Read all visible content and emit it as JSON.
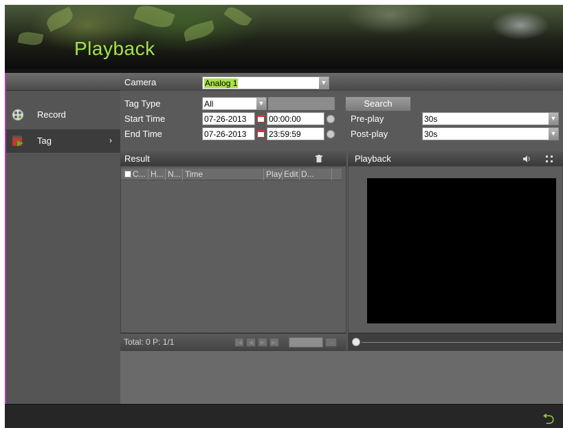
{
  "window": {
    "title": "Playback"
  },
  "sidebar": {
    "items": [
      {
        "label": "Record",
        "icon": "record-icon"
      },
      {
        "label": "Tag",
        "icon": "tag-icon",
        "selected": true
      }
    ]
  },
  "form": {
    "camera_label": "Camera",
    "camera_value": "Analog 1",
    "tag_type_label": "Tag Type",
    "tag_type_value": "All",
    "tag_keyword_value": "",
    "start_time_label": "Start Time",
    "start_date": "07-26-2013",
    "start_time": "00:00:00",
    "end_time_label": "End Time",
    "end_date": "07-26-2013",
    "end_time": "23:59:59",
    "search_label": "Search",
    "preplay_label": "Pre-play",
    "preplay_value": "30s",
    "postplay_label": "Post-play",
    "postplay_value": "30s"
  },
  "result": {
    "title": "Result",
    "columns": [
      "C...",
      "H...",
      "N...",
      "Time",
      "Play",
      "Edit",
      "D..."
    ],
    "rows": [],
    "pager_text": "Total: 0  P: 1/1",
    "page_input": ""
  },
  "playback": {
    "title": "Playback",
    "progress": 0
  },
  "colors": {
    "title_green": "#a5e14a",
    "accent_pink": "#b33ab3",
    "back_green": "#8fd13a"
  }
}
